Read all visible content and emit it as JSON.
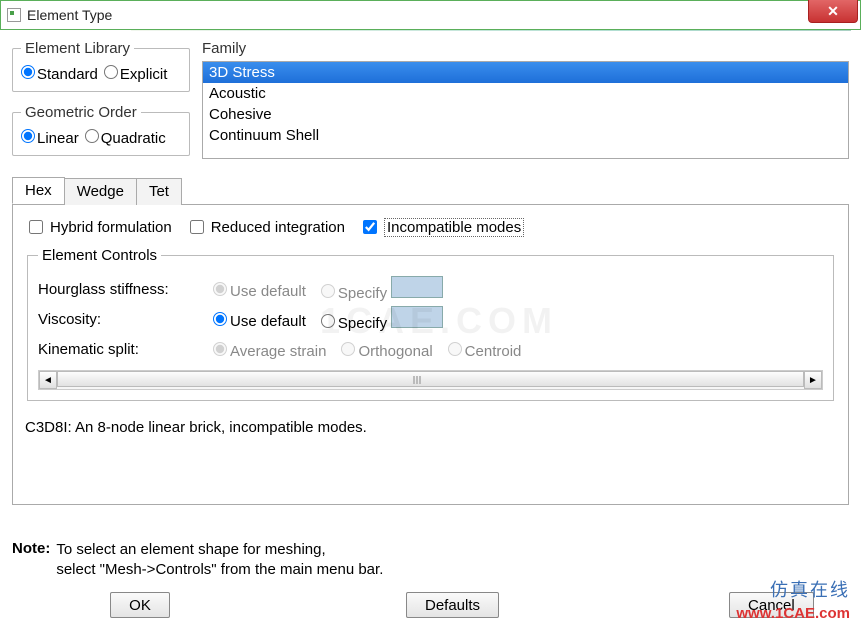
{
  "window": {
    "title": "Element Type"
  },
  "library": {
    "legend": "Element Library",
    "standard": "Standard",
    "explicit": "Explicit"
  },
  "geometric": {
    "legend": "Geometric Order",
    "linear": "Linear",
    "quadratic": "Quadratic"
  },
  "family": {
    "legend": "Family",
    "items": [
      "3D Stress",
      "Acoustic",
      "Cohesive",
      "Continuum Shell"
    ]
  },
  "tabs": {
    "hex": "Hex",
    "wedge": "Wedge",
    "tet": "Tet"
  },
  "checks": {
    "hybrid": "Hybrid formulation",
    "reduced": "Reduced integration",
    "incompatible": "Incompatible modes"
  },
  "controls": {
    "legend": "Element Controls",
    "rows": {
      "hourglass": {
        "label": "Hourglass stiffness:",
        "opt1": "Use default",
        "opt2": "Specify"
      },
      "viscosity": {
        "label": "Viscosity:",
        "opt1": "Use default",
        "opt2": "Specify"
      },
      "kinematic": {
        "label": "Kinematic split:",
        "opt1": "Average strain",
        "opt2": "Orthogonal",
        "opt3": "Centroid"
      }
    }
  },
  "description": "C3D8I:  An 8-node linear brick, incompatible modes.",
  "note": {
    "label": "Note:",
    "line1": "To select an element shape for meshing,",
    "line2": "select \"Mesh->Controls\" from the main menu bar."
  },
  "buttons": {
    "ok": "OK",
    "defaults": "Defaults",
    "cancel": "Cancel"
  },
  "watermark": {
    "cn": "仿真在线",
    "url": "www.1CAE.com"
  }
}
